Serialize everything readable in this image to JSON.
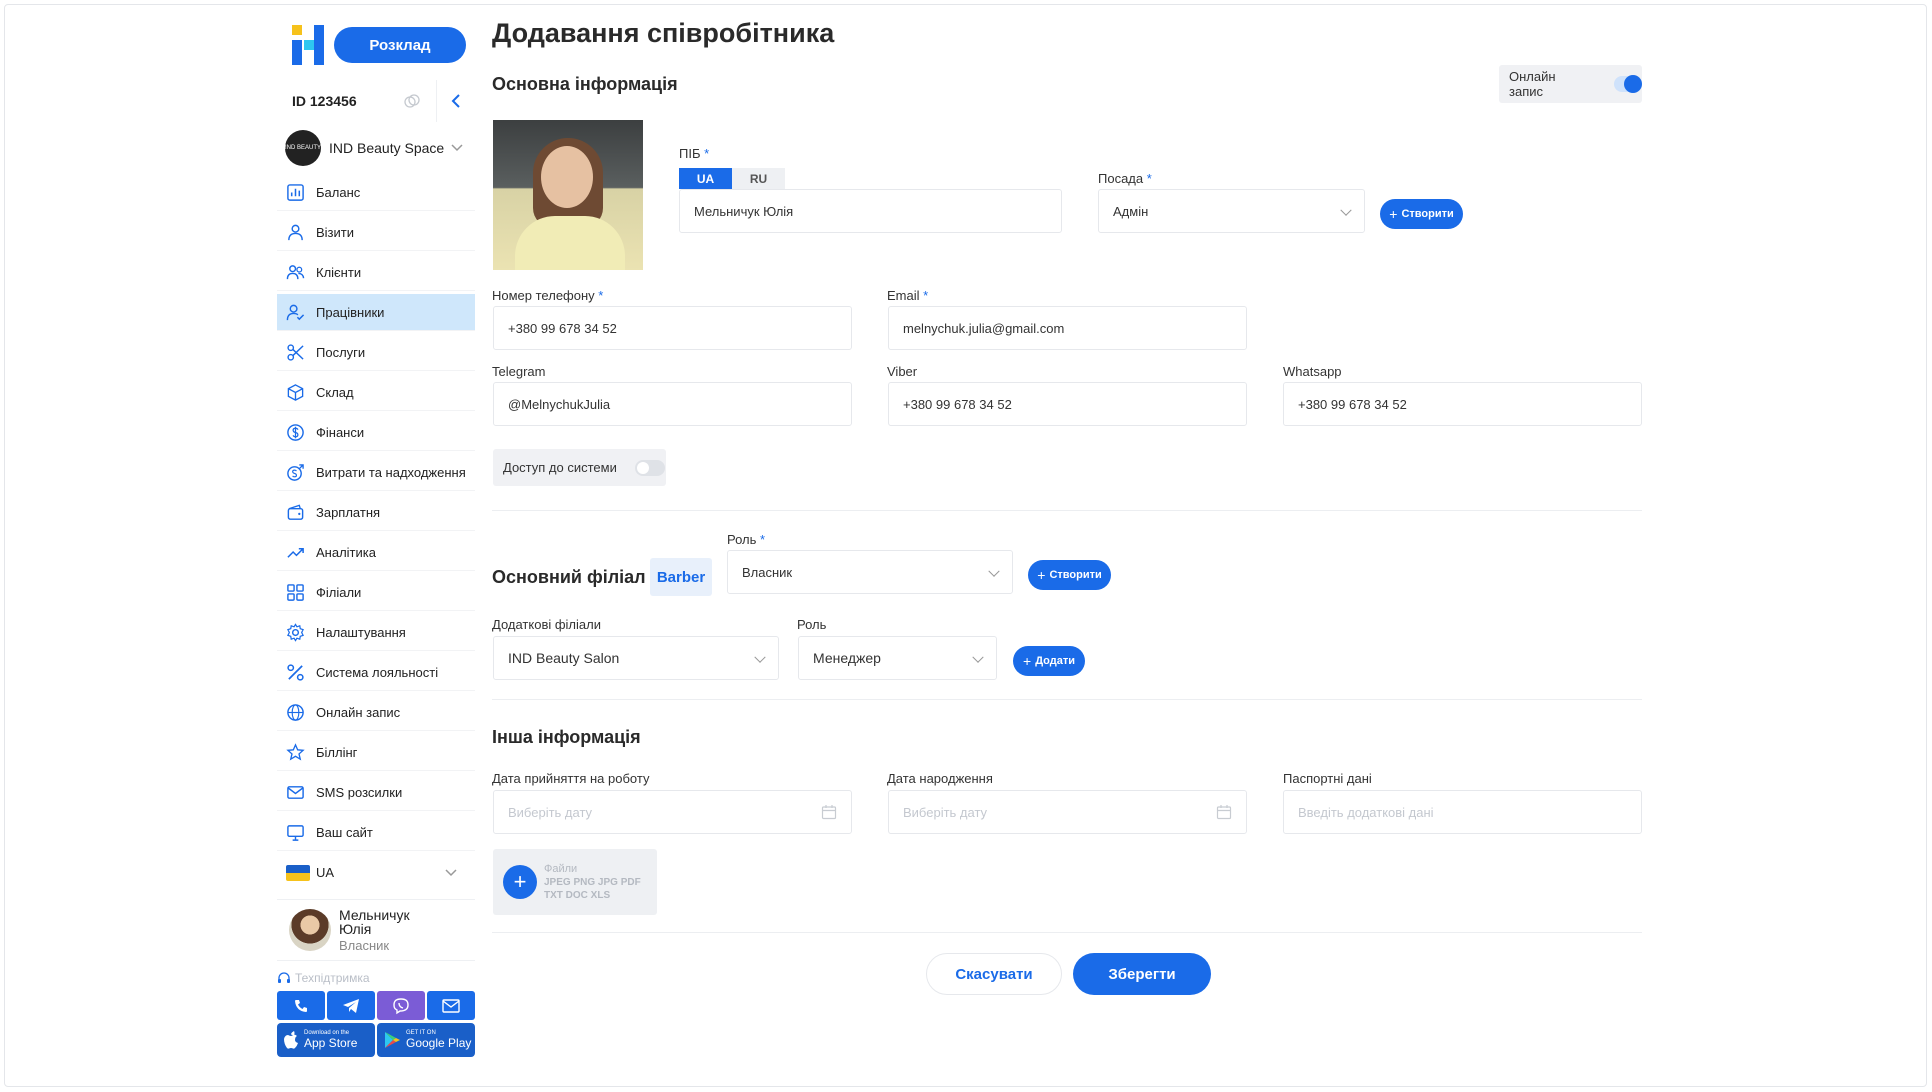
{
  "sidebar": {
    "schedule_button": "Розклад",
    "account_id": "ID 123456",
    "company_name": "IND Beauty Space",
    "company_logo_text": "IND BEAUTY",
    "items": [
      {
        "label": "Баланс",
        "icon": "chart-icon"
      },
      {
        "label": "Візити",
        "icon": "user-icon"
      },
      {
        "label": "Клієнти",
        "icon": "users-icon"
      },
      {
        "label": "Працівники",
        "icon": "user-check-icon",
        "active": true
      },
      {
        "label": "Послуги",
        "icon": "scissors-icon"
      },
      {
        "label": "Склад",
        "icon": "box-icon"
      },
      {
        "label": "Фінанси",
        "icon": "dollar-icon"
      },
      {
        "label": "Витрати та надходження",
        "icon": "cash-flow-icon"
      },
      {
        "label": "Зарплатня",
        "icon": "wallet-icon"
      },
      {
        "label": "Аналітика",
        "icon": "trend-icon"
      },
      {
        "label": "Філіали",
        "icon": "grid-icon"
      },
      {
        "label": "Налаштування",
        "icon": "gear-icon"
      },
      {
        "label": "Система лояльності",
        "icon": "percent-icon"
      },
      {
        "label": "Онлайн запис",
        "icon": "globe-icon"
      },
      {
        "label": "Біллінг",
        "icon": "star-icon"
      },
      {
        "label": "SMS розсилки",
        "icon": "mail-icon"
      },
      {
        "label": "Ваш сайт",
        "icon": "monitor-icon"
      }
    ],
    "language": "UA",
    "user": {
      "name": "Мельничук Юлія",
      "role": "Власник"
    },
    "support_label": "Техпідтримка",
    "app_store": {
      "small": "Download on the",
      "big": "App Store"
    },
    "google_play": {
      "small": "GET IT ON",
      "big": "Google Play"
    }
  },
  "main": {
    "page_title": "Додавання співробітника",
    "basic_info_title": "Основна інформація",
    "online_booking_label": "Онлайн запис",
    "online_booking_on": true,
    "full_name": {
      "label": "ПІБ",
      "tab_ua": "UA",
      "tab_ru": "RU",
      "value": "Мельничук Юлія"
    },
    "position": {
      "label": "Посада",
      "value": "Адмін",
      "create_button": "Створити"
    },
    "phone": {
      "label": "Номер телефону",
      "value": "+380 99 678 34 52"
    },
    "email": {
      "label": "Email",
      "value": "melnychuk.julia@gmail.com"
    },
    "telegram": {
      "label": "Telegram",
      "value": "@MelnychukJulia"
    },
    "viber": {
      "label": "Viber",
      "value": "+380 99 678 34 52"
    },
    "whatsapp": {
      "label": "Whatsapp",
      "value": "+380 99 678 34 52"
    },
    "system_access_label": "Доступ до системи",
    "system_access_on": false,
    "main_branch": {
      "title": "Основний філіал",
      "badge": "Barber",
      "role_label": "Роль",
      "role_value": "Власник",
      "create_button": "Створити"
    },
    "extra_branches": {
      "label": "Додаткові філіали",
      "value": "IND Beauty Salon",
      "role_label": "Роль",
      "role_value": "Менеджер",
      "add_button": "Додати"
    },
    "other_info_title": "Інша інформація",
    "hire_date": {
      "label": "Дата прийняття на роботу",
      "placeholder": "Виберіть дату"
    },
    "birth_date": {
      "label": "Дата народження",
      "placeholder": "Виберіть дату"
    },
    "passport": {
      "label": "Паспортні дані",
      "placeholder": "Введіть додаткові дані"
    },
    "files": {
      "title": "Файли",
      "formats_line1": "JPEG PNG JPG PDF",
      "formats_line2": "TXT DOC XLS"
    },
    "cancel_button": "Скасувати",
    "save_button": "Зберегти"
  },
  "colors": {
    "accent": "#1a6be8",
    "active_nav": "#cfe7fb",
    "viber": "#7b5cd6"
  }
}
